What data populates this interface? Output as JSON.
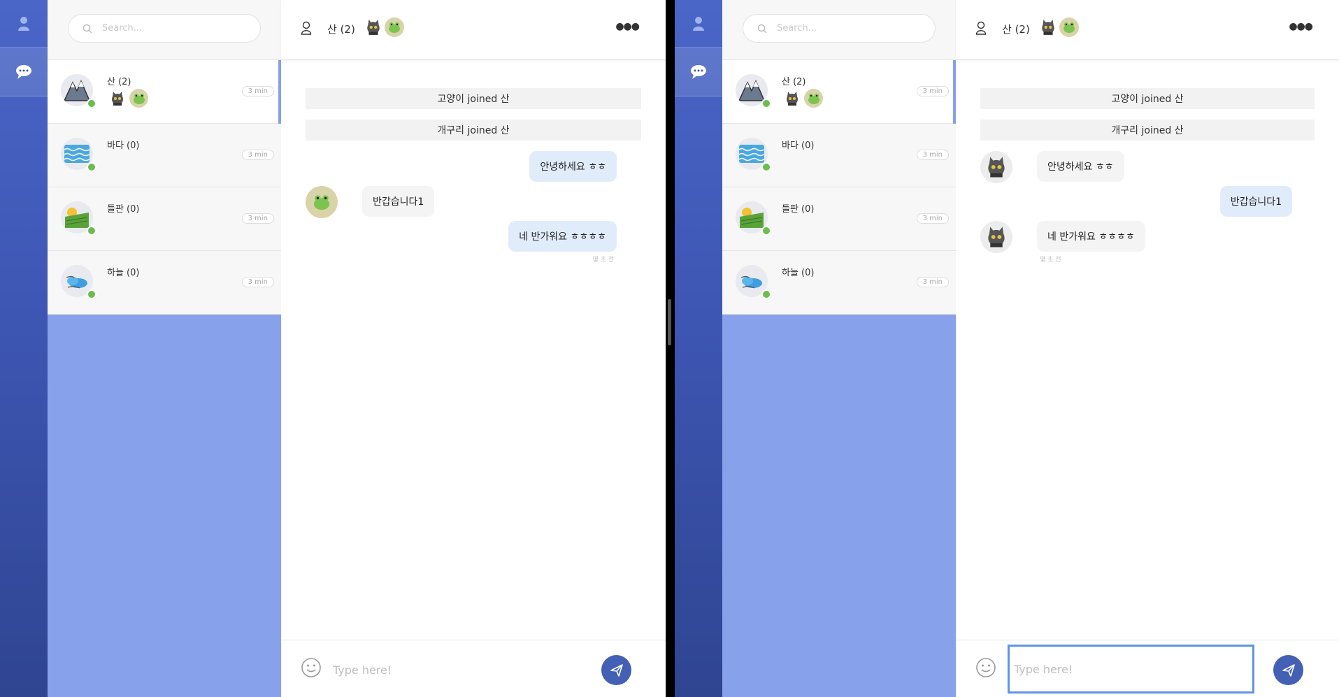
{
  "search": {
    "placeholder": "Search..."
  },
  "rooms": [
    {
      "name": "산 (2)",
      "time": "3 min",
      "icon": "mountain-icon"
    },
    {
      "name": "바다 (0)",
      "time": "3 min",
      "icon": "sea-icon"
    },
    {
      "name": "들판 (0)",
      "time": "3 min",
      "icon": "field-icon"
    },
    {
      "name": "하늘 (0)",
      "time": "3 min",
      "icon": "sky-icon"
    }
  ],
  "chat": {
    "title": "산 (2)",
    "composer_placeholder": "Type here!"
  },
  "left_messages": {
    "sys1": "고양이 joined 산",
    "sys2": "개구리 joined 산",
    "m1": "안녕하세요 ㅎㅎ",
    "m2": "반갑습니다1",
    "m3": "네 반가워요 ㅎㅎㅎㅎ",
    "m3_time": "몇 초 전"
  },
  "right_messages": {
    "sys1": "고양이 joined 산",
    "sys2": "개구리 joined 산",
    "m1": "안녕하세요 ㅎㅎ",
    "m2": "반갑습니다1",
    "m3": "네 반가워요 ㅎㅎㅎㅎ",
    "m3_time": "몇 초 전"
  },
  "colors": {
    "nav": "#3f58b6",
    "list_bg": "#87a1ea",
    "online": "#6bbd4c",
    "my_bubble": "#e1ecfb",
    "send": "#4460b4",
    "focus": "#5f95e3"
  }
}
